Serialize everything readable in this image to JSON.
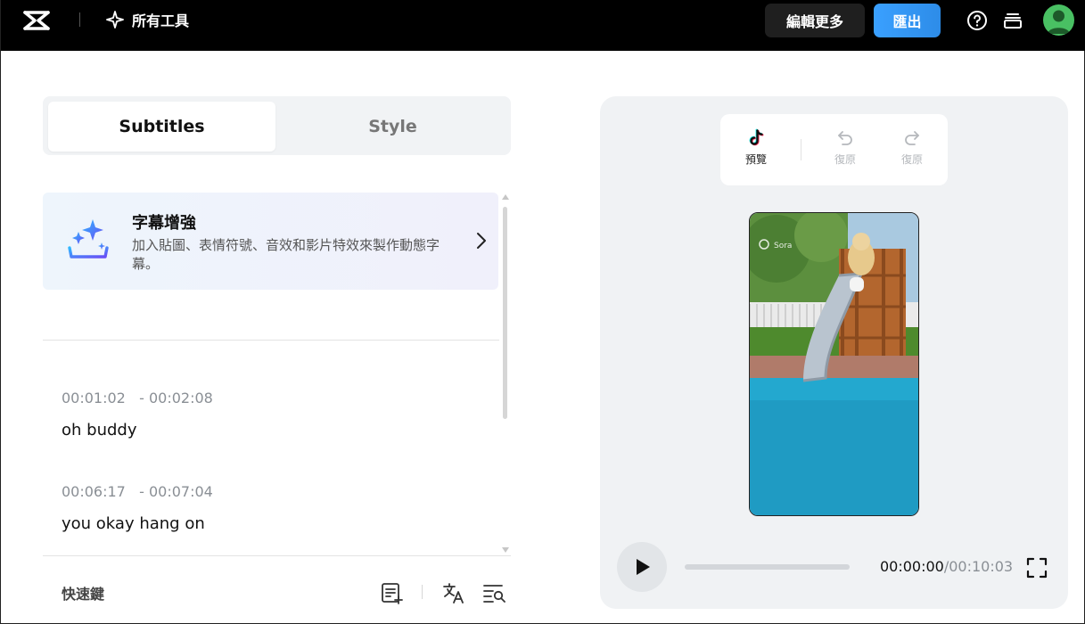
{
  "topbar": {
    "all_tools_label": "所有工具",
    "edit_more_label": "編輯更多",
    "export_label": "匯出"
  },
  "tabs": [
    {
      "label": "Subtitles",
      "active": true
    },
    {
      "label": "Style",
      "active": false
    }
  ],
  "enhance": {
    "title": "字幕增強",
    "description": "加入貼圖、表情符號、音效和影片特效來製作動態字幕。"
  },
  "subtitles": [
    {
      "start": "00:01:02",
      "end": "- 00:02:08",
      "text": "oh buddy"
    },
    {
      "start": "00:06:17",
      "end": "- 00:07:04",
      "text": "you okay hang on"
    }
  ],
  "footer": {
    "shortcuts_label": "快速鍵"
  },
  "preview": {
    "toolbar": {
      "tiktok_label": "預覽",
      "undo_label": "復原",
      "redo_label": "復原"
    },
    "video_watermark": "Sora",
    "playback_progress": 0,
    "current_time": "00:00:00",
    "total_time": "/00:10:03"
  },
  "colors": {
    "topbar_bg": "#000000",
    "export_blue": "#3aa0ff",
    "avatar_green": "#49c063",
    "panel_bg": "#f0f2f4"
  }
}
